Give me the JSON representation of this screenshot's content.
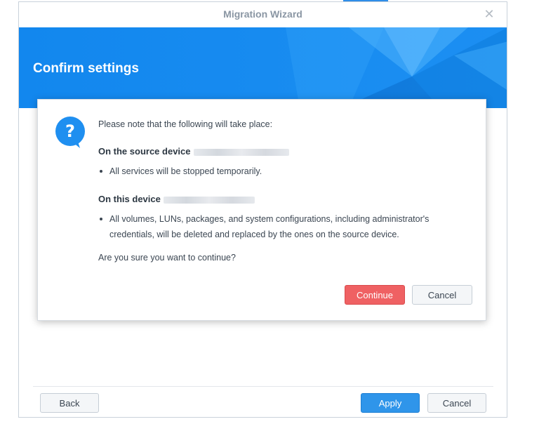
{
  "window": {
    "title": "Migration Wizard"
  },
  "banner": {
    "title": "Confirm settings"
  },
  "dialog": {
    "intro": "Please note that the following will take place:",
    "source_heading": "On the source device",
    "source_bullet": "All services will be stopped temporarily.",
    "this_heading": "On this device",
    "this_bullet_line1": "All volumes, LUNs, packages, and system configurations, including administrator's",
    "this_bullet_line2": "credentials, will be deleted and replaced by the ones on the source device.",
    "question": "Are you sure you want to continue?",
    "continue_label": "Continue",
    "cancel_label": "Cancel",
    "icon": "question-icon"
  },
  "footer": {
    "back_label": "Back",
    "apply_label": "Apply",
    "cancel_label": "Cancel"
  },
  "colors": {
    "accent": "#2f95ea",
    "danger": "#ef6163",
    "banner": "#1a8ff0"
  }
}
